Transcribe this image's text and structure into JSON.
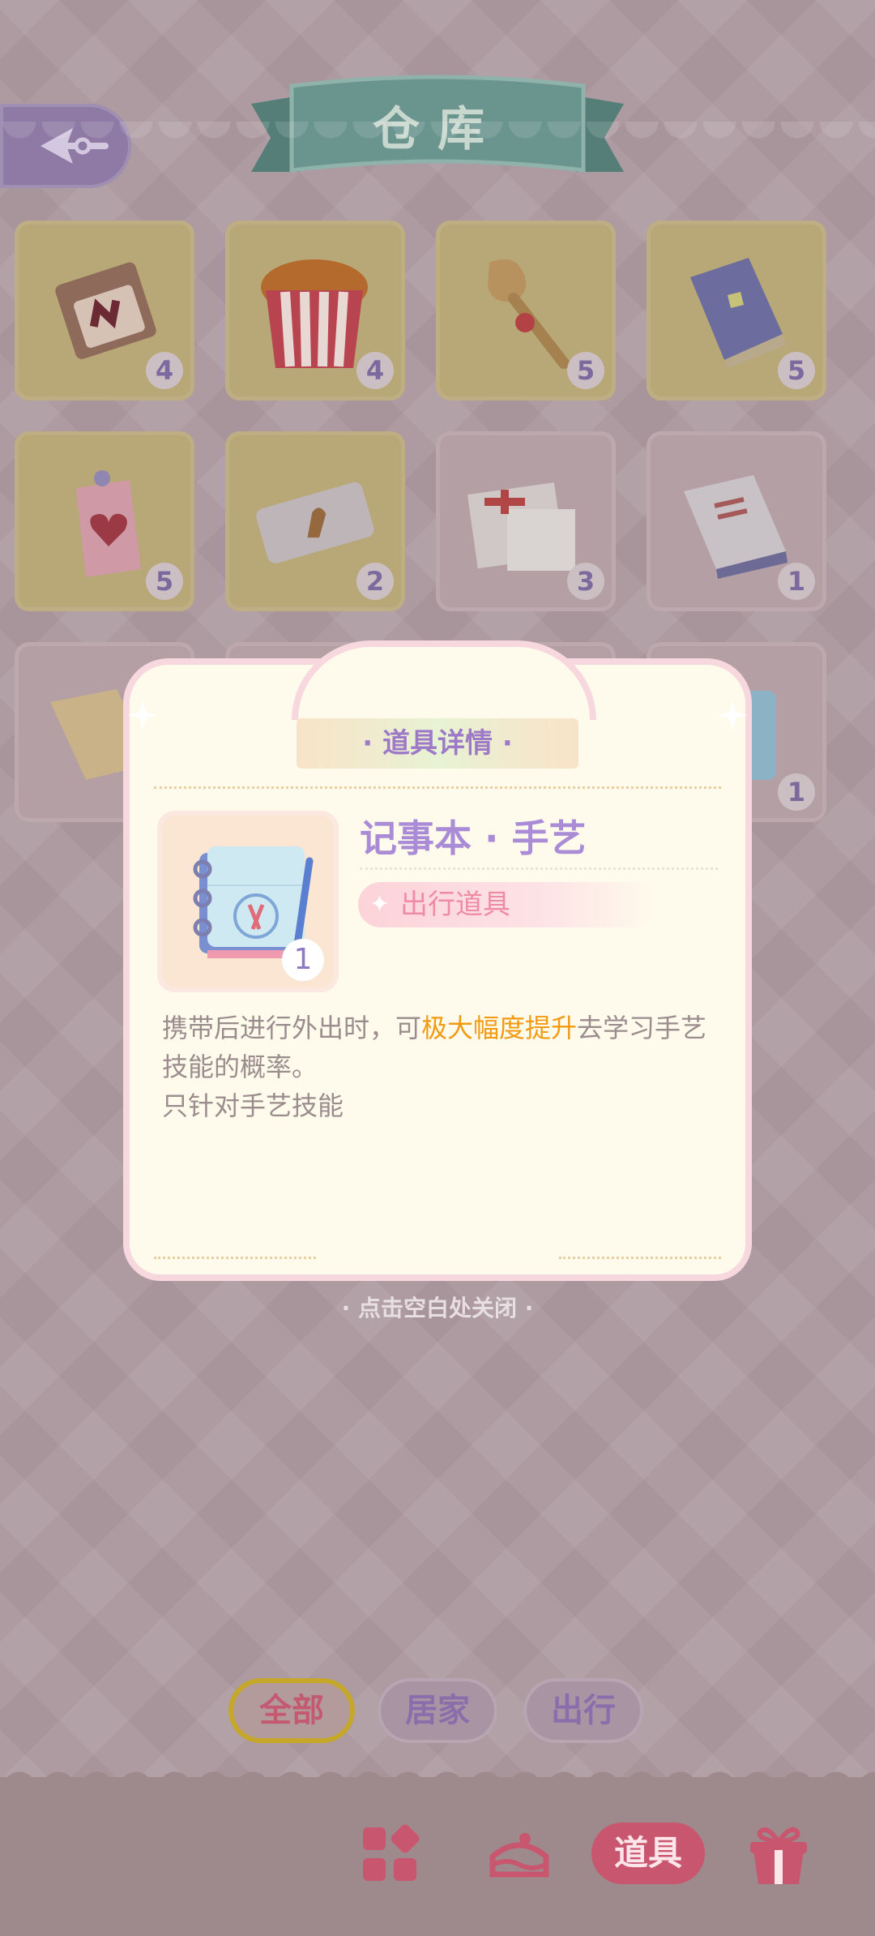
{
  "header": {
    "title": "仓库",
    "back_icon": "back-arrow-icon"
  },
  "grid": {
    "items": [
      {
        "name": "chocolate-box-icon",
        "count": "4",
        "tile": "yellow"
      },
      {
        "name": "fried-chicken-bucket-icon",
        "count": "4",
        "tile": "yellow"
      },
      {
        "name": "wooden-staff-icon",
        "count": "5",
        "tile": "yellow"
      },
      {
        "name": "blue-book-icon",
        "count": "5",
        "tile": "yellow"
      },
      {
        "name": "heart-charm-icon",
        "count": "5",
        "tile": "yellow"
      },
      {
        "name": "food-ticket-icon",
        "count": "2",
        "tile": "yellow"
      },
      {
        "name": "medical-documents-icon",
        "count": "3",
        "tile": "pink"
      },
      {
        "name": "encyclopedia-book-icon",
        "count": "1",
        "tile": "pink"
      },
      {
        "name": "craft-book-icon",
        "count": "",
        "tile": "pink"
      },
      {
        "name": "purple-item-icon",
        "count": "",
        "tile": "pink"
      },
      {
        "name": "hidden-item-icon",
        "count": "",
        "tile": "pink"
      },
      {
        "name": "craft-notebook-icon",
        "count": "1",
        "tile": "pink"
      }
    ]
  },
  "modal": {
    "tag": "· 道具详情 ·",
    "item_name": "记事本 · 手艺",
    "item_type": "出行道具",
    "item_count": "1",
    "desc_1a": "携带后进行外出时，可",
    "desc_1b": "极大幅度提升",
    "desc_1c": "去学习手艺技能的概率。",
    "desc_2": "只针对手艺技能",
    "highlight_color": "#f29a12"
  },
  "close_hint": "· 点击空白处关闭 ·",
  "tabs": {
    "all": "全部",
    "home": "居家",
    "out": "出行"
  },
  "bottom_nav": {
    "items": [
      "grid-icon",
      "cake-icon",
      "道具",
      "gift-box-icon"
    ],
    "active_label": "道具"
  }
}
